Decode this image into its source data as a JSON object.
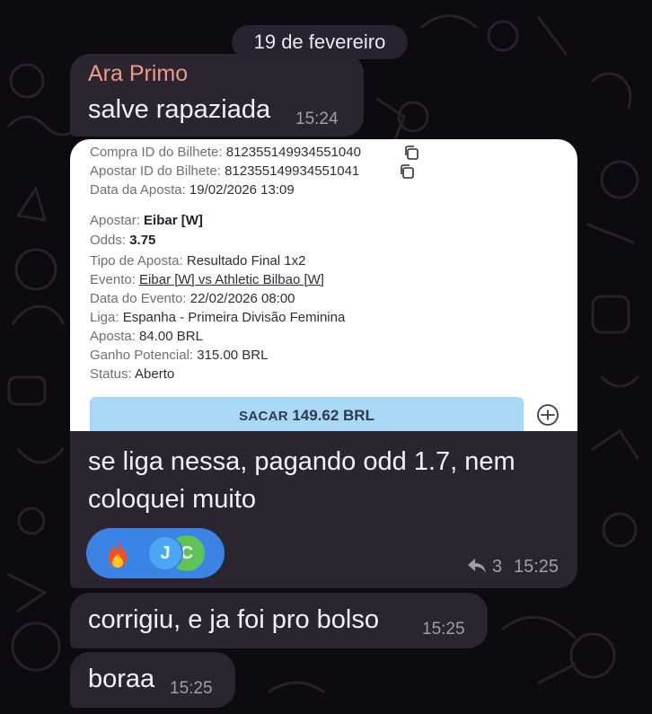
{
  "chat": {
    "date_separator": "19 de fevereiro",
    "messages": [
      {
        "sender": "Ara Primo",
        "text": "salve rapaziada",
        "time": "15:24"
      },
      {
        "screenshot": {
          "lines": [
            {
              "label": "Compra ID do Bilhete: ",
              "value": "812355149934551040"
            },
            {
              "label": "Apostar ID do Bilhete: ",
              "value": "812355149934551041"
            },
            {
              "label": "Data da Aposta: ",
              "value": "19/02/2026 13:09"
            },
            {
              "label": "Apostar: ",
              "value": "Eibar [W]"
            },
            {
              "label": "Odds: ",
              "value": "3.75"
            },
            {
              "label": "Tipo de Aposta: ",
              "value": "Resultado Final 1x2"
            },
            {
              "label": "Evento: ",
              "value": "Eibar [W] vs Athletic Bilbao [W]"
            },
            {
              "label": "Data do Evento: ",
              "value": "22/02/2026 08:00"
            },
            {
              "label": "Liga: ",
              "value": "Espanha - Primeira Divisão Feminina"
            },
            {
              "label": "Aposta: ",
              "value": "84.00 BRL"
            },
            {
              "label": "Ganho Potencial: ",
              "value": "315.00 BRL"
            },
            {
              "label": "Status: ",
              "value": "Aberto"
            }
          ],
          "cashout_label": "SACAR",
          "cashout_amount": "149.62 BRL"
        },
        "text_line1": "se liga nessa, pagando odd 1.7, nem",
        "text_line2": "coloquei muito",
        "reactions": {
          "emoji": "fire",
          "avatar1": "C",
          "avatar2": "J"
        },
        "replies": "3",
        "time": "15:25"
      },
      {
        "text": "corrigiu, e ja foi pro bolso",
        "time": "15:25"
      },
      {
        "text": "boraa",
        "time": "15:25"
      }
    ]
  },
  "colors": {
    "background": "#0d0a10",
    "bubble": "#2b2531",
    "sender": "#f0998a",
    "reaction_pill": "#3c83e6",
    "cashout_button": "#a9d8f7"
  }
}
